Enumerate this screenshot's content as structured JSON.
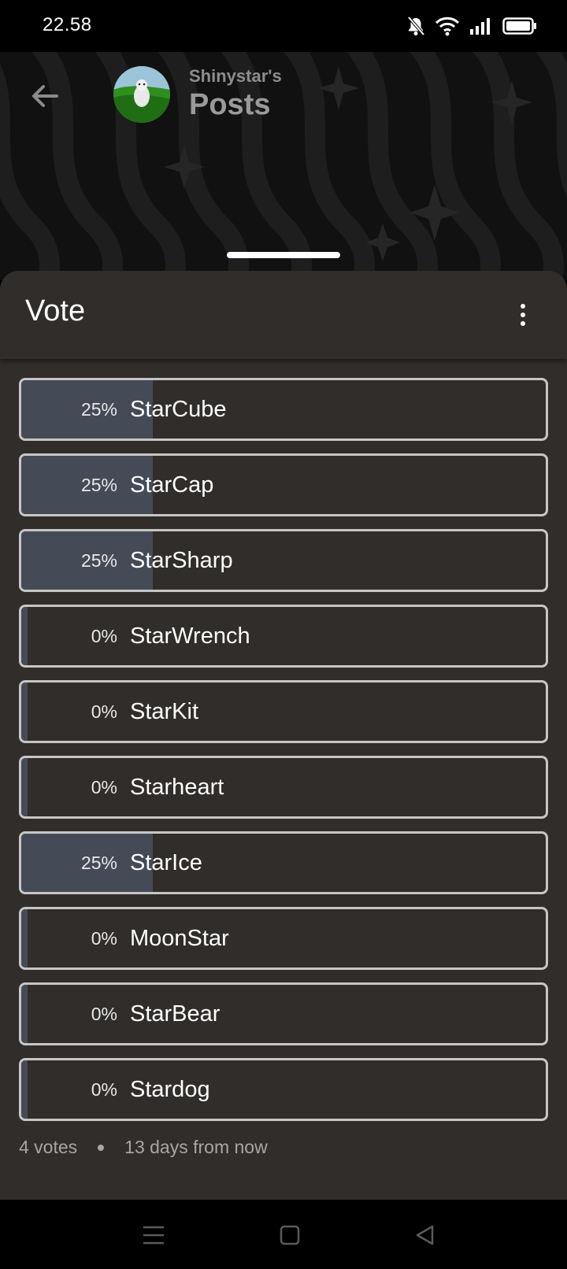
{
  "status_bar": {
    "time": "22.58",
    "icons": [
      "bell-muted-icon",
      "wifi-icon",
      "signal-icon",
      "battery-icon"
    ]
  },
  "header": {
    "subtitle": "Shinystar's",
    "title": "Posts",
    "back_icon": "arrow-left-icon"
  },
  "sheet": {
    "title": "Vote",
    "menu_icon": "more-vertical-icon"
  },
  "poll": {
    "options": [
      {
        "percent": "25%",
        "label": "StarCube",
        "fraction": 0.25
      },
      {
        "percent": "25%",
        "label": "StarCap",
        "fraction": 0.25
      },
      {
        "percent": "25%",
        "label": "StarSharp",
        "fraction": 0.25
      },
      {
        "percent": "0%",
        "label": "StarWrench",
        "fraction": 0
      },
      {
        "percent": "0%",
        "label": "StarKit",
        "fraction": 0
      },
      {
        "percent": "0%",
        "label": "Starheart",
        "fraction": 0
      },
      {
        "percent": "25%",
        "label": "StarIce",
        "fraction": 0.25
      },
      {
        "percent": "0%",
        "label": "MoonStar",
        "fraction": 0
      },
      {
        "percent": "0%",
        "label": "StarBear",
        "fraction": 0
      },
      {
        "percent": "0%",
        "label": "Stardog",
        "fraction": 0
      }
    ],
    "votes": "4 votes",
    "time_remaining": "13 days from now"
  },
  "colors": {
    "sheet_bg": "#302d2a",
    "fill": "#454a57",
    "border": "#c8c6c4"
  },
  "nav": {
    "icons": [
      "menu-icon",
      "home-square-icon",
      "back-triangle-icon"
    ]
  }
}
